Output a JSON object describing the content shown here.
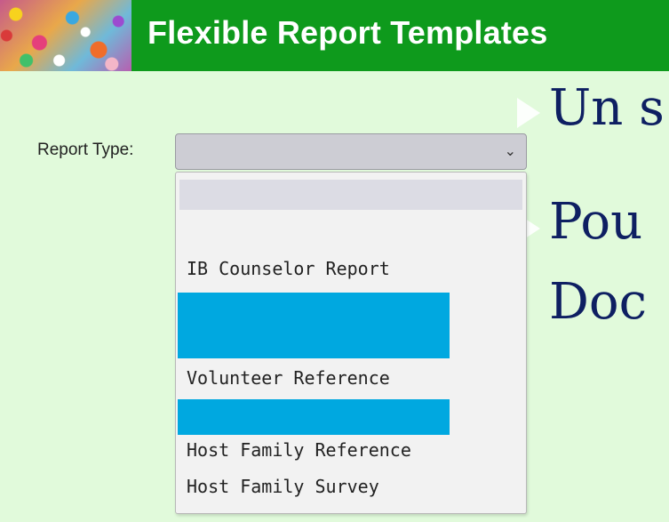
{
  "banner": {
    "title": "Flexible Report Templates",
    "color": "#0e9a1c"
  },
  "slide": {
    "line1": "Un s",
    "line2": "Pou",
    "line3": "Doc",
    "text_color": "#0e1f62"
  },
  "form": {
    "report_type_label": "Report Type:",
    "selected_value": "",
    "chevron_icon": "chevron-down-icon"
  },
  "dropdown": {
    "highlight_color": "#00a8e0",
    "options": [
      {
        "label": ""
      },
      {
        "label": "IB Counselor Report"
      },
      {
        "label": "",
        "highlighted": true
      },
      {
        "label": "Volunteer Reference"
      },
      {
        "label": "",
        "highlighted": true
      },
      {
        "label": "Host Family Reference"
      },
      {
        "label": "Host Family Survey"
      }
    ]
  }
}
